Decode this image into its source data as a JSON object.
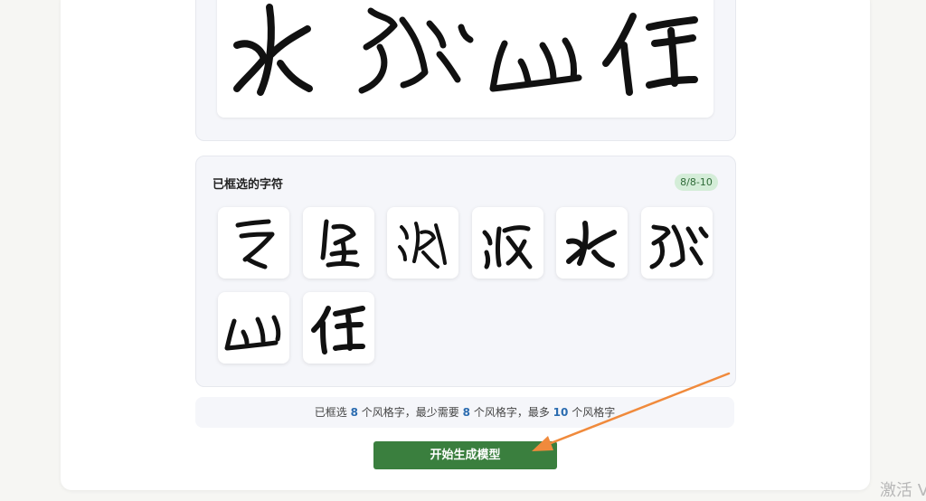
{
  "selected_section": {
    "title": "已框选的字符",
    "count_badge": "8/8-10"
  },
  "info": {
    "prefix": "已框选",
    "selected": "8",
    "part1": "个风格字，最少需要",
    "min": "8",
    "part2": "个风格字，最多",
    "max": "10",
    "part3": "个风格字"
  },
  "start_button": {
    "label": "开始生成模型"
  },
  "watermark": {
    "text": "激活 V"
  },
  "colors": {
    "accent_green": "#3a7f3e",
    "badge_bg": "#d4edd8",
    "number_blue": "#2b6cb0",
    "annotation_arrow": "#f08a3c"
  },
  "icons": {
    "preview_glyphs": [
      "calligraphy-glyph-4",
      "calligraphy-glyph-5",
      "calligraphy-glyph-6",
      "calligraphy-glyph-7"
    ],
    "tiles": [
      "calligraphy-glyph-0",
      "calligraphy-glyph-1",
      "calligraphy-glyph-2",
      "calligraphy-glyph-3",
      "calligraphy-glyph-4",
      "calligraphy-glyph-5",
      "calligraphy-glyph-6",
      "calligraphy-glyph-7"
    ]
  }
}
